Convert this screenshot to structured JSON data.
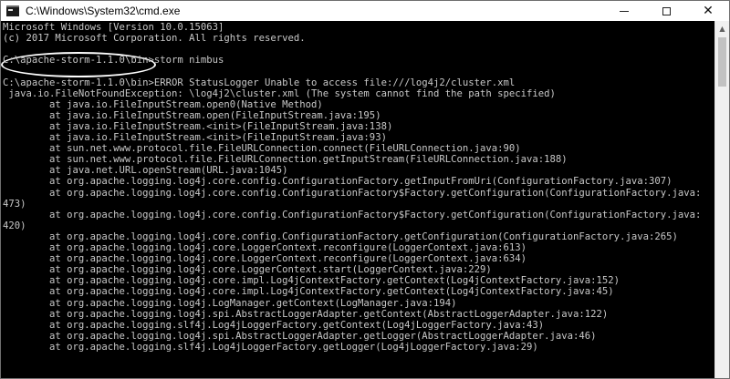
{
  "window": {
    "title": "C:\\Windows\\System32\\cmd.exe",
    "icon": "cmd-icon"
  },
  "controls": {
    "minimize_icon": "minimize-icon",
    "maximize_icon": "maximize-icon",
    "close_icon": "close-icon",
    "close_glyph": "✕"
  },
  "console": {
    "lines": [
      "Microsoft Windows [Version 10.0.15063]",
      "(c) 2017 Microsoft Corporation. All rights reserved.",
      "",
      "C:\\apache-storm-1.1.0\\bin>storm nimbus",
      "",
      "C:\\apache-storm-1.1.0\\bin>ERROR StatusLogger Unable to access file:///log4j2/cluster.xml",
      " java.io.FileNotFoundException: \\log4j2\\cluster.xml (The system cannot find the path specified)",
      "        at java.io.FileInputStream.open0(Native Method)",
      "        at java.io.FileInputStream.open(FileInputStream.java:195)",
      "        at java.io.FileInputStream.<init>(FileInputStream.java:138)",
      "        at java.io.FileInputStream.<init>(FileInputStream.java:93)",
      "        at sun.net.www.protocol.file.FileURLConnection.connect(FileURLConnection.java:90)",
      "        at sun.net.www.protocol.file.FileURLConnection.getInputStream(FileURLConnection.java:188)",
      "        at java.net.URL.openStream(URL.java:1045)",
      "        at org.apache.logging.log4j.core.config.ConfigurationFactory.getInputFromUri(ConfigurationFactory.java:307)",
      "        at org.apache.logging.log4j.core.config.ConfigurationFactory$Factory.getConfiguration(ConfigurationFactory.java:",
      "473)",
      "        at org.apache.logging.log4j.core.config.ConfigurationFactory$Factory.getConfiguration(ConfigurationFactory.java:",
      "420)",
      "        at org.apache.logging.log4j.core.config.ConfigurationFactory.getConfiguration(ConfigurationFactory.java:265)",
      "        at org.apache.logging.log4j.core.LoggerContext.reconfigure(LoggerContext.java:613)",
      "        at org.apache.logging.log4j.core.LoggerContext.reconfigure(LoggerContext.java:634)",
      "        at org.apache.logging.log4j.core.LoggerContext.start(LoggerContext.java:229)",
      "        at org.apache.logging.log4j.core.impl.Log4jContextFactory.getContext(Log4jContextFactory.java:152)",
      "        at org.apache.logging.log4j.core.impl.Log4jContextFactory.getContext(Log4jContextFactory.java:45)",
      "        at org.apache.logging.log4j.LogManager.getContext(LogManager.java:194)",
      "        at org.apache.logging.log4j.spi.AbstractLoggerAdapter.getContext(AbstractLoggerAdapter.java:122)",
      "        at org.apache.logging.slf4j.Log4jLoggerFactory.getContext(Log4jLoggerFactory.java:43)",
      "        at org.apache.logging.log4j.spi.AbstractLoggerAdapter.getLogger(AbstractLoggerAdapter.java:46)",
      "        at org.apache.logging.slf4j.Log4jLoggerFactory.getLogger(Log4jLoggerFactory.java:29)"
    ],
    "text_color": "#c8c8c8",
    "background_color": "#000000"
  },
  "scrollbar": {
    "up_arrow_icon": "scroll-up-arrow-icon"
  }
}
